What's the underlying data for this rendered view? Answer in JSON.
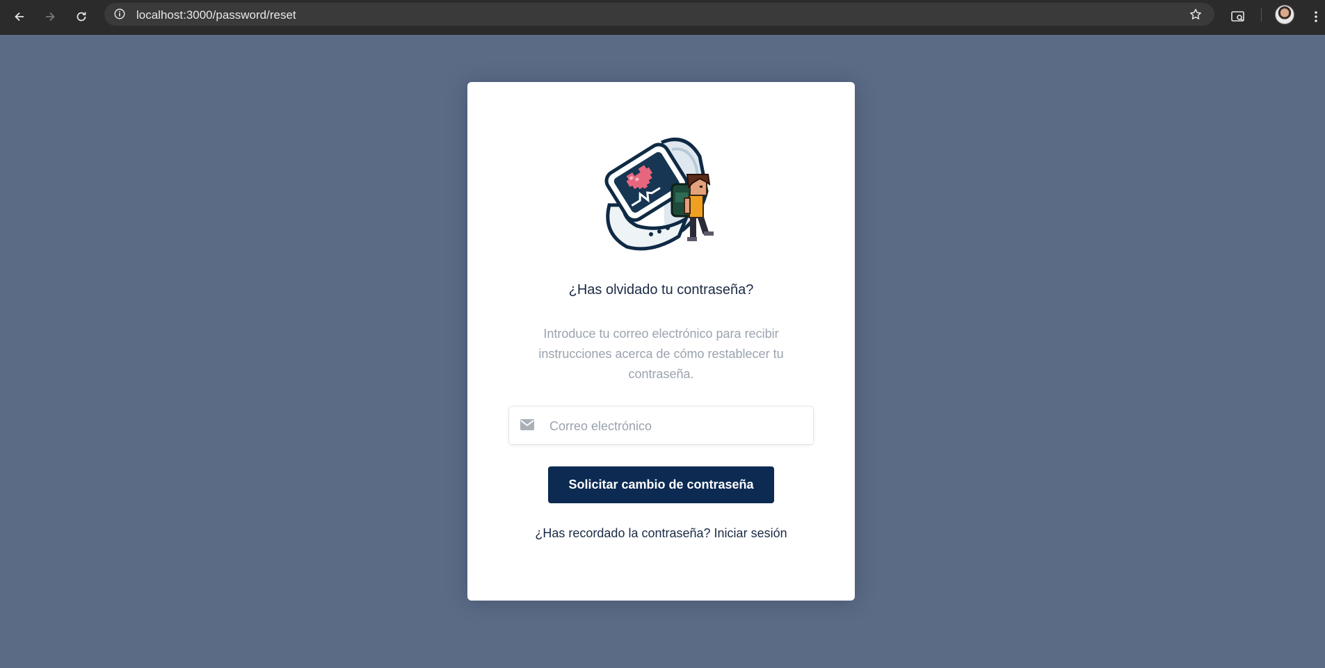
{
  "browser": {
    "url": "localhost:3000/password/reset",
    "icons": [
      "back-arrow-icon",
      "forward-arrow-icon",
      "reload-icon",
      "site-info-icon",
      "bookmark-star-icon",
      "search-tab-icon",
      "profile-avatar",
      "kebab-menu-icon"
    ]
  },
  "page": {
    "background_color": "#5b6b86",
    "accent_color": "#0c2a52"
  },
  "card": {
    "illustration": "smartwatch-heart-hiker-illustration",
    "title": "¿Has olvidado tu contraseña?",
    "description": "Introduce tu correo electrónico para recibir instrucciones acerca de cómo restablecer tu contraseña.",
    "email_placeholder": "Correo electrónico",
    "email_value": "",
    "submit_label": "Solicitar cambio de contraseña",
    "remember_text": "¿Has recordado la contraseña?",
    "login_link": "Iniciar sesión"
  }
}
